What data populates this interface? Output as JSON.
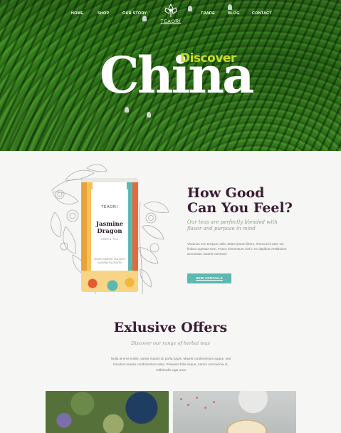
{
  "nav": {
    "items": [
      "HOME",
      "SHOP",
      "OUR STORY",
      "TRADE",
      "BLOG",
      "CONTACT"
    ],
    "logo_text": "TEAORI"
  },
  "hero": {
    "title": "China",
    "overline": "Discover"
  },
  "product": {
    "brand": "TEAORI",
    "name_line1": "Jasmine",
    "name_line2": "Dragon",
    "type": "GREEN TEA",
    "desc": "PEARL SHAPED TEA WITH JASMINE BLOSSOM"
  },
  "feature": {
    "heading_line1": "How Good",
    "heading_line2": "Can You Feel?",
    "subheading": "Our teas are perfectly blended with flavor and purpose in mind",
    "body": "Vivamus non tempus nulla. Etiam ipsum libero, rhoncus id ante vel, finibus egestas sem. Fusce elementum nisl in ex dapibus vestibulum accumsan mauris euismod.",
    "button_label": "NEW ARRIVALS"
  },
  "offers": {
    "heading": "Exlusive Offers",
    "subheading": "Discover our range of herbal teas",
    "body": "Nulla at eros mollis, varius mauris id, porta turpis. Mauris condimentum augue, sed tincidunt massa condimentum vitae. Praesent felis neque, rutrum non lacinia ut, sollicitudin eget urna"
  },
  "colors": {
    "accent": "#5cb8b0",
    "heading": "#3a1d35",
    "lime": "#c6dc27",
    "muted_green": "#8fa08a"
  },
  "icons": [
    "lotus-logo-icon",
    "botanical-illustration",
    "tea-tin-image",
    "herbs-photo",
    "teapot-photo"
  ]
}
